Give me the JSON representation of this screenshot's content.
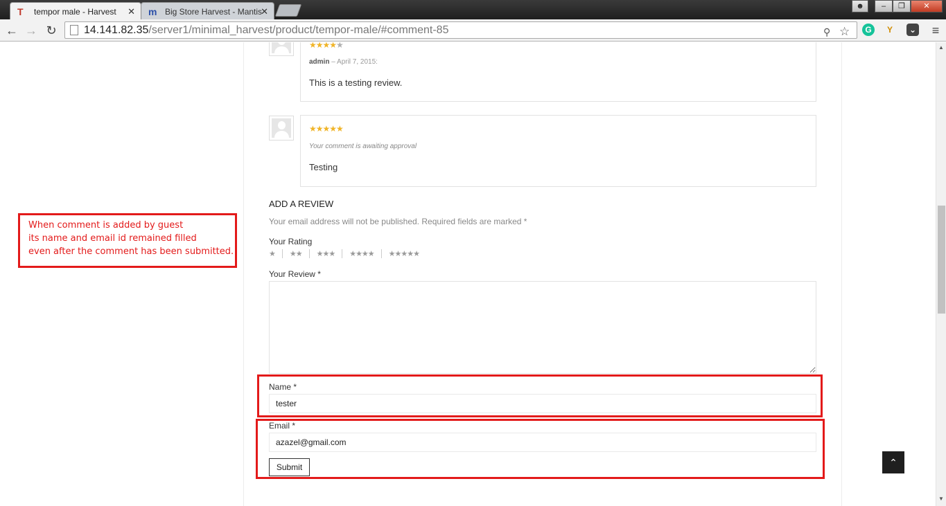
{
  "browser": {
    "tabs": [
      {
        "favicon": "T",
        "title": "tempor male - Harvest",
        "close": "✕"
      },
      {
        "favicon": "m",
        "title": "Big Store Harvest - Mantis",
        "close": "✕"
      }
    ],
    "url_host": "14.141.82.35",
    "url_path": "/server1/minimal_harvest/product/tempor-male/#comment-85",
    "window_controls": {
      "minimize": "–",
      "restore": "❐",
      "close": "✕"
    },
    "nav_icons": {
      "back": "←",
      "forward": "→",
      "reload": "↻",
      "zoom": "🔍",
      "star": "☆",
      "menu": "≡"
    }
  },
  "reviews": [
    {
      "rating": 4,
      "stars_on": "★★★★",
      "stars_off": "★",
      "author": "admin",
      "date": " – April 7, 2015:",
      "text": "This is a testing review."
    },
    {
      "rating": 5,
      "stars_on": "★★★★★",
      "stars_off": "",
      "awaiting": "Your comment is awaiting approval",
      "text": "Testing"
    }
  ],
  "form": {
    "heading": "Add a review",
    "notes": "Your email address will not be published. Required fields are marked *",
    "rating_label": "Your Rating",
    "rating_options": [
      "★",
      "★★",
      "★★★",
      "★★★★",
      "★★★★★"
    ],
    "review_label": "Your Review *",
    "name_label": "Name *",
    "name_value": "tester",
    "email_label": "Email *",
    "email_value": "azazel@gmail.com",
    "submit_label": "Submit"
  },
  "annotation": {
    "line1": "When comment is added by guest",
    "line2": "its name and email id remained filled",
    "line3": "even after the comment has been submitted."
  },
  "colors": {
    "annotation_red": "#e31a1a",
    "star_gold": "#f0b427"
  },
  "back_to_top_icon": "chevron-up-icon"
}
